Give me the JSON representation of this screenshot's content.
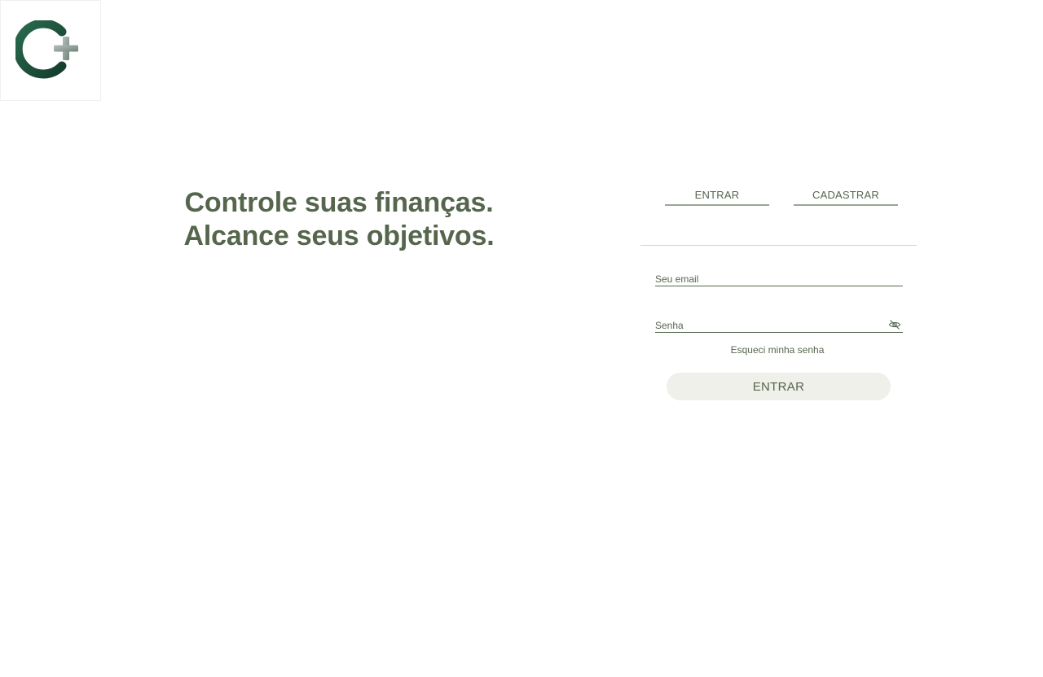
{
  "app": {
    "logo_icon": "c-plus-logo-icon"
  },
  "hero": {
    "line1": "Controle suas finanças.",
    "line2": "Alcance seus objetivos."
  },
  "auth": {
    "tabs": [
      {
        "label": "ENTRAR",
        "active": true
      },
      {
        "label": "CADASTRAR",
        "active": false
      }
    ],
    "email": {
      "placeholder": "Seu email",
      "value": ""
    },
    "password": {
      "placeholder": "Senha",
      "value": "",
      "toggle_icon": "eye-off-icon"
    },
    "forgot_label": "Esqueci minha senha",
    "submit_label": "ENTRAR"
  },
  "colors": {
    "brand_green": "#55664d",
    "tab_underline": "#97a891",
    "button_bg": "#eef0e9",
    "logo_dark": "#1f4d3a"
  }
}
